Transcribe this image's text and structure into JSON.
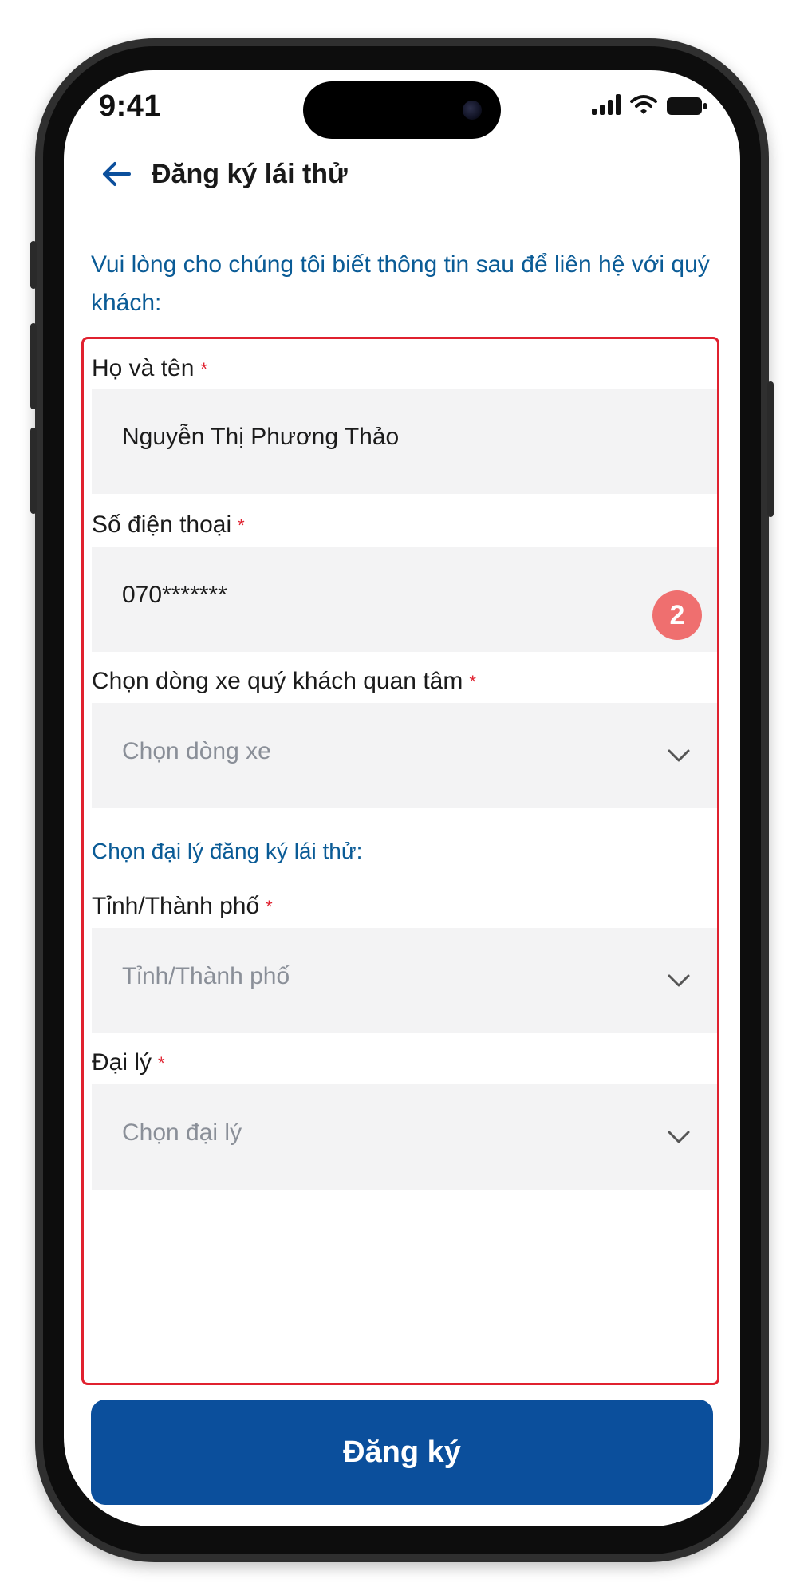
{
  "status_bar": {
    "time": "9:41",
    "icons": [
      "signal-icon",
      "wifi-icon",
      "battery-icon"
    ]
  },
  "header": {
    "back_icon": "arrow-left-icon",
    "title": "Đăng ký lái thử"
  },
  "intro_text": "Vui lòng cho chúng tôi biết thông tin sau để liên hệ với quý khách:",
  "form": {
    "required_mark": "*",
    "full_name": {
      "label": "Họ và tên",
      "value": "Nguyễn Thị Phương Thảo"
    },
    "phone": {
      "label": "Số điện thoại",
      "value": "070*******"
    },
    "car_model": {
      "label": "Chọn dòng xe quý khách quan tâm",
      "placeholder": "Chọn dòng xe"
    },
    "dealer_section_title": "Chọn đại lý đăng ký lái thử:",
    "province": {
      "label": "Tỉnh/Thành phố",
      "placeholder": "Tỉnh/Thành phố"
    },
    "dealer": {
      "label": "Đại lý",
      "placeholder": "Chọn đại lý"
    }
  },
  "step_badge": "2",
  "submit_label": "Đăng ký",
  "colors": {
    "primary": "#0b4f9c",
    "link_text": "#0a5b96",
    "highlight_border": "#e0212f",
    "badge": "#ef6f6f",
    "input_bg": "#f3f3f4"
  }
}
